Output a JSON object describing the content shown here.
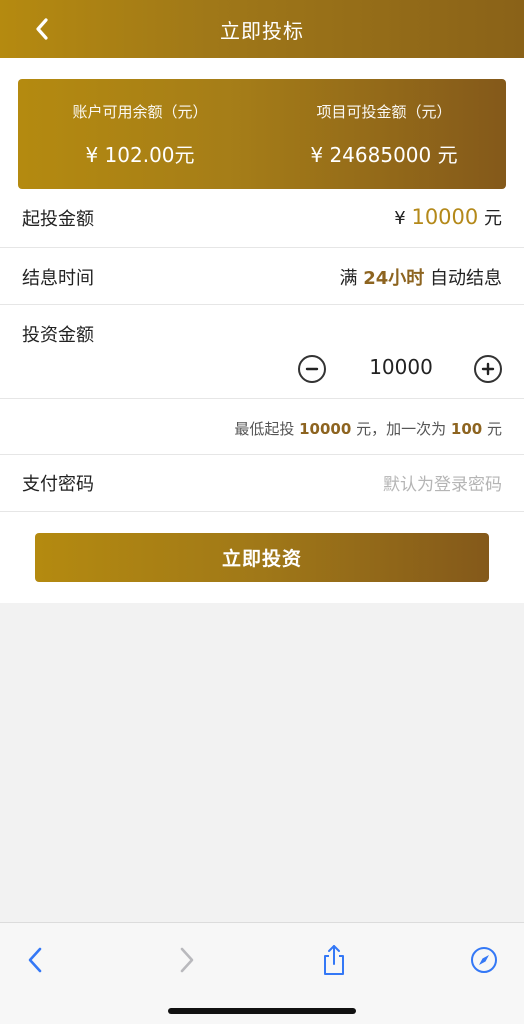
{
  "header": {
    "title": "立即投标"
  },
  "summary": {
    "balance_label": "账户可用余额（元）",
    "balance_value": "¥ 102.00元",
    "investable_label": "项目可投金额（元）",
    "investable_value": "¥ 24685000 元"
  },
  "rows": {
    "min_invest_label": "起投金额",
    "min_invest_currency": "¥",
    "min_invest_amount": "10000",
    "min_invest_unit": "元",
    "settle_label": "结息时间",
    "settle_prefix": "满",
    "settle_hours": "24小时",
    "settle_suffix": "自动结息",
    "invest_label": "投资金额",
    "invest_amount": "10000"
  },
  "hint": {
    "prefix": "最低起投",
    "min": "10000",
    "middle": "元，加一次为",
    "step": "100",
    "suffix": "元"
  },
  "password": {
    "label": "支付密码",
    "placeholder": "默认为登录密码"
  },
  "submit_label": "立即投资",
  "colors": {
    "accent_gold": "#b4891a",
    "accent_brown": "#8d6420",
    "ios_blue": "#3478f6"
  },
  "toolbar_icons": [
    "back-arrow-icon",
    "forward-arrow-icon",
    "share-icon",
    "compass-icon"
  ]
}
